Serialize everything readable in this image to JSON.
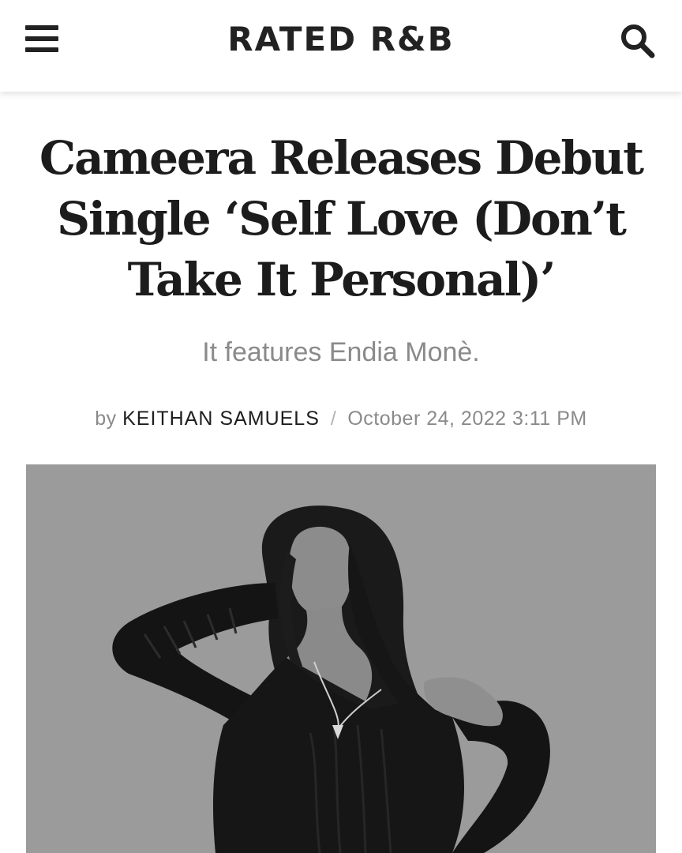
{
  "header": {
    "logo": "RATED R&B",
    "menu_icon": "hamburger-menu-icon",
    "search_icon": "search-icon"
  },
  "article": {
    "title": "Cameera Releases Debut Single ‘Self Love (Don’t Take It Personal)’",
    "subtitle": "It features Endia Monè.",
    "byline": {
      "prefix": "by",
      "author": "KEITHAN SAMUELS",
      "separator": "/",
      "date": "October 24, 2022 3:11 PM"
    }
  },
  "colors": {
    "text_dark": "#1c1c1c",
    "text_muted": "#8a8a8a",
    "photo_background": "#9b9b9b"
  }
}
